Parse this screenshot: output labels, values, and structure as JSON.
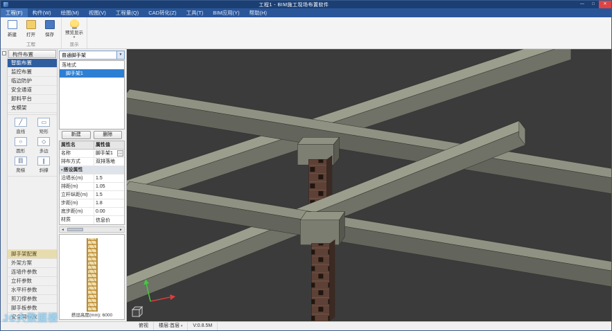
{
  "colors": {
    "titlebar": "#1b3f73",
    "menubar": "#2a5699",
    "menu_active_tab": "#4172b8",
    "selection_blue": "#2d7fd3",
    "viewport_background": "#3b3b3b",
    "beam_top": "#8f9182",
    "beam_front": "#63645b",
    "brick_column": "#5e4136",
    "close_button": "#e04343"
  },
  "window": {
    "title": "工程1 - BIM施工现场布置软件",
    "minimize": "—",
    "maximize": "□",
    "close": "✕"
  },
  "menu": {
    "tabs": [
      {
        "label": "工程(F)"
      },
      {
        "label": "构件(W)"
      },
      {
        "label": "绘图(M)"
      },
      {
        "label": "视图(V)"
      },
      {
        "label": "工程量(Q)"
      },
      {
        "label": "CAD转化(Z)"
      },
      {
        "label": "工具(T)"
      },
      {
        "label": "BIM应用(Y)"
      },
      {
        "label": "帮助(H)"
      }
    ]
  },
  "ribbon": {
    "file_buttons": [
      {
        "label": "新建"
      },
      {
        "label": "打开"
      },
      {
        "label": "保存"
      }
    ],
    "file_group_label": "工程",
    "preview_button": {
      "label": "预览显示",
      "arrow": "▾"
    },
    "preview_group_label": "显示"
  },
  "sidebar": {
    "nav_items": [
      {
        "label": "构件布置"
      },
      {
        "label": "智能布置"
      },
      {
        "label": "监控布置"
      },
      {
        "label": "临边防护"
      },
      {
        "label": "安全通道"
      },
      {
        "label": "卸料平台"
      },
      {
        "label": "支模架"
      }
    ],
    "tools": [
      {
        "label": "直线",
        "icon": "╱"
      },
      {
        "label": "矩形",
        "icon": "▭"
      },
      {
        "label": "圆形",
        "icon": "○"
      },
      {
        "label": "多边",
        "icon": "◇"
      },
      {
        "label": "爬梯",
        "icon": "目"
      },
      {
        "label": "斜撑",
        "icon": "∥"
      }
    ],
    "param_items": [
      {
        "label": "脚手架配置"
      },
      {
        "label": "外架方案"
      },
      {
        "label": "连墙件参数"
      },
      {
        "label": "立杆参数"
      },
      {
        "label": "水平杆参数"
      },
      {
        "label": "剪刀撑参数"
      },
      {
        "label": "脚手板参数"
      },
      {
        "label": "安全网参数"
      }
    ]
  },
  "panel": {
    "combo": {
      "value": "普通脚手架",
      "arrow": "▼"
    },
    "list": {
      "group_label": "落地式",
      "items": [
        {
          "label": "脚手架1"
        }
      ]
    },
    "buttons": [
      {
        "label": "新建"
      },
      {
        "label": "删除"
      }
    ],
    "table": {
      "headers": [
        "属性名",
        "属性值"
      ],
      "expander": "▾",
      "ellipsis": "…",
      "rows": [
        {
          "name": "名称",
          "value": "脚手架1"
        },
        {
          "name": "排布方式",
          "value": "双排落地"
        },
        {
          "name": "搭设属性",
          "value": ""
        },
        {
          "name": "沿墙长(m)",
          "value": "1.5"
        },
        {
          "name": "排距(m)",
          "value": "1.05"
        },
        {
          "name": "立杆纵距(m)",
          "value": "1.5"
        },
        {
          "name": "步距(m)",
          "value": "1.8"
        },
        {
          "name": "底步距(m)",
          "value": "0.00"
        },
        {
          "name": "材质",
          "value": "信息价"
        }
      ]
    },
    "hscroll": {
      "left": "◄",
      "right": "►"
    },
    "preview": {
      "caption": "搭设高度(mm): 6000"
    }
  },
  "viewport": {
    "watermark": "JC大数据楼"
  },
  "statusbar": {
    "view": "俯视",
    "floor": "楼层:首层",
    "floor_arrow": "▾",
    "memory": "V:0.8.5M"
  }
}
